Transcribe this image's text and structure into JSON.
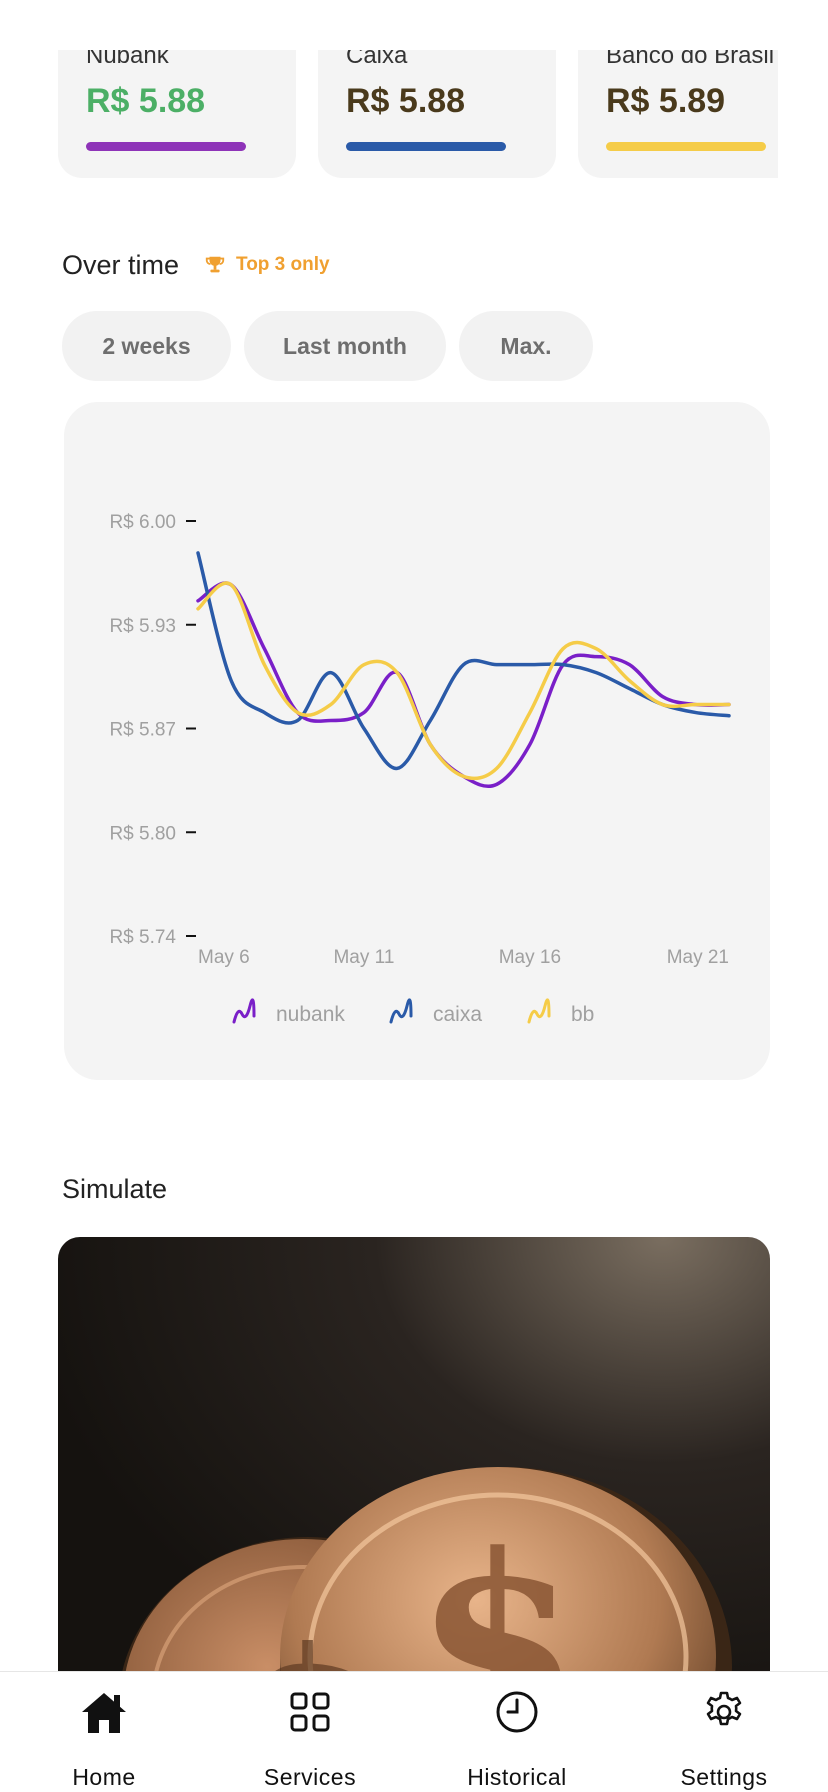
{
  "cards": [
    {
      "bank": "Nubank",
      "rate": "R$ 5.88",
      "rate_color": "#4caf66",
      "bar_color": "#8e33b8"
    },
    {
      "bank": "Caixa",
      "rate": "R$ 5.88",
      "rate_color": "#4a3a1c",
      "bar_color": "#2a5aa8"
    },
    {
      "bank": "Banco do Brasil",
      "rate": "R$ 5.89",
      "rate_color": "#4a3a1c",
      "bar_color": "#f5cc48"
    }
  ],
  "over_time": {
    "title": "Over time",
    "badge_label": "Top 3 only",
    "badge_icon": "trophy-icon",
    "badge_color": "#f0a030"
  },
  "periods": [
    {
      "label": "2 weeks",
      "active": true
    },
    {
      "label": "Last month",
      "active": false
    },
    {
      "label": "Max.",
      "active": false
    }
  ],
  "chart_data": {
    "type": "line",
    "x": [
      "May 6",
      "May 7",
      "May 8",
      "May 9",
      "May 10",
      "May 11",
      "May 12",
      "May 13",
      "May 14",
      "May 15",
      "May 16",
      "May 17",
      "May 18",
      "May 19",
      "May 20",
      "May 21",
      "May 22"
    ],
    "x_tick_labels": [
      "May 6",
      "May 11",
      "May 16",
      "May 21"
    ],
    "y_tick_labels": [
      "R$ 6.00",
      "R$ 5.93",
      "R$ 5.87",
      "R$ 5.80",
      "R$ 5.74"
    ],
    "ylim": [
      5.74,
      6.0
    ],
    "series": [
      {
        "name": "nubank",
        "color": "#7a1fc8",
        "values": [
          5.95,
          5.96,
          5.92,
          5.88,
          5.875,
          5.88,
          5.905,
          5.86,
          5.84,
          5.835,
          5.86,
          5.91,
          5.915,
          5.91,
          5.89,
          5.885,
          5.885
        ]
      },
      {
        "name": "caixa",
        "color": "#2a5aa8",
        "values": [
          5.98,
          5.9,
          5.88,
          5.875,
          5.905,
          5.87,
          5.845,
          5.875,
          5.91,
          5.91,
          5.91,
          5.91,
          5.905,
          5.895,
          5.885,
          5.88,
          5.878
        ]
      },
      {
        "name": "bb",
        "color": "#f5cc48",
        "values": [
          5.945,
          5.96,
          5.91,
          5.88,
          5.885,
          5.91,
          5.905,
          5.86,
          5.84,
          5.845,
          5.88,
          5.92,
          5.92,
          5.9,
          5.885,
          5.885,
          5.885
        ]
      }
    ],
    "legend_position": "bottom",
    "grid": false
  },
  "simulate": {
    "title": "Simulate"
  },
  "nav": [
    {
      "label": "Home",
      "icon": "home-icon"
    },
    {
      "label": "Services",
      "icon": "grid-icon"
    },
    {
      "label": "Historical",
      "icon": "clock-icon"
    },
    {
      "label": "Settings",
      "icon": "gear-icon"
    }
  ]
}
